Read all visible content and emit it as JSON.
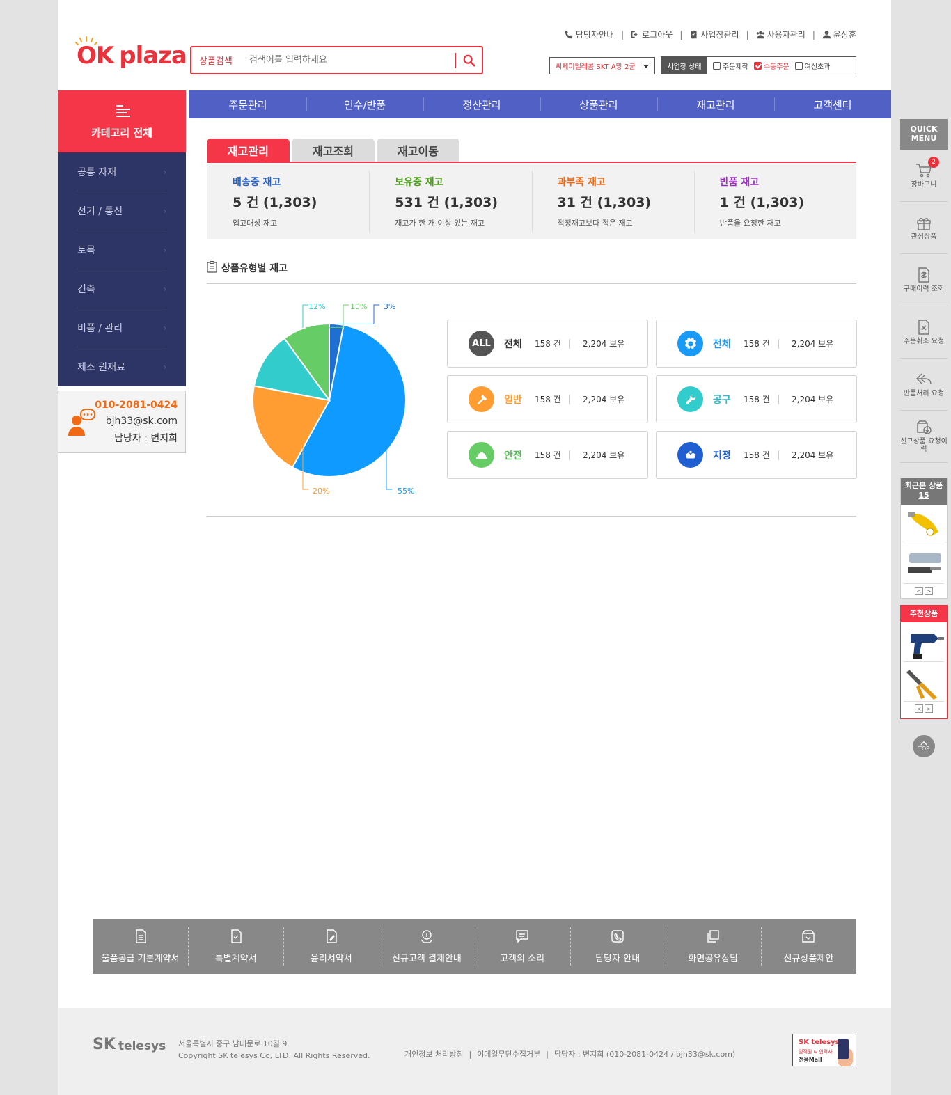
{
  "header": {
    "logo_ok": "OK",
    "logo_plaza": "plaza",
    "search_label": "상품검색",
    "search_placeholder": "검색어를 입력하세요",
    "util_links": [
      "담당자안내",
      "로그아웃",
      "사업장관리",
      "사용자관리",
      "윤상훈"
    ],
    "site_select": "씨제이텔레콤 SKT A망 2군",
    "status_label": "사업장 상태",
    "status_options": [
      {
        "label": "주문제작",
        "checked": false
      },
      {
        "label": "수동주문",
        "checked": true
      },
      {
        "label": "여신초과",
        "checked": false
      }
    ]
  },
  "sidebar": {
    "title": "카테고리 전체",
    "items": [
      "공통 자재",
      "전기 / 통신",
      "토목",
      "건축",
      "비품 / 관리",
      "제조 원재료"
    ],
    "contact_phone": "010-2081-0424",
    "contact_email": "bjh33@sk.com",
    "contact_manager": "담당자 : 변지희"
  },
  "nav": [
    "주문관리",
    "인수/반품",
    "정산관리",
    "상품관리",
    "재고관리",
    "고객센터"
  ],
  "tabs": [
    "재고관리",
    "재고조회",
    "재고이동"
  ],
  "summary": [
    {
      "title": "배송중 재고",
      "value": "5 건  (1,303)",
      "desc": "입고대상 재고",
      "color": "#2a63c5"
    },
    {
      "title": "보유중 재고",
      "value": "531 건  (1,303)",
      "desc": "재고가 한 개 이상 있는 재고",
      "color": "#4aa017"
    },
    {
      "title": "과부족 재고",
      "value": "31 건  (1,303)",
      "desc": "적정재고보다 적은 재고",
      "color": "#f06a15"
    },
    {
      "title": "반품 재고",
      "value": "1 건  (1,303)",
      "desc": "반품을 요청한 재고",
      "color": "#9a2fc0"
    }
  ],
  "section_title": "상품유형별 재고",
  "chart_data": {
    "type": "pie",
    "slices": [
      {
        "label": "3%",
        "value": 3,
        "color": "#1f6fd1"
      },
      {
        "label": "55%",
        "value": 55,
        "color": "#0f9aff"
      },
      {
        "label": "20%",
        "value": 20,
        "color": "#ff9d33"
      },
      {
        "label": "12%",
        "value": 12,
        "color": "#33cccc"
      },
      {
        "label": "10%",
        "value": 10,
        "color": "#66cc66"
      }
    ]
  },
  "cards": [
    {
      "icon": "all-icon",
      "icon_text": "ALL",
      "name": "전체",
      "count": "158 건",
      "stock": "2,204 보유",
      "color": "#555555",
      "name_color": "#333333"
    },
    {
      "icon": "gear-icon",
      "icon_text": "",
      "name": "전체",
      "count": "158 건",
      "stock": "2,204 보유",
      "color": "#1a9af7",
      "name_color": "#1a9af7"
    },
    {
      "icon": "hammer-icon",
      "icon_text": "",
      "name": "일반",
      "count": "158 건",
      "stock": "2,204 보유",
      "color": "#ff9d33",
      "name_color": "#ff9d33"
    },
    {
      "icon": "wrench-icon",
      "icon_text": "",
      "name": "공구",
      "count": "158 건",
      "stock": "2,204 보유",
      "color": "#33cccc",
      "name_color": "#33bbcc"
    },
    {
      "icon": "helmet-icon",
      "icon_text": "",
      "name": "안전",
      "count": "158 건",
      "stock": "2,204 보유",
      "color": "#66cc66",
      "name_color": "#55bb55"
    },
    {
      "icon": "designated-icon",
      "icon_text": "",
      "name": "지정",
      "count": "158 건",
      "stock": "2,204 보유",
      "color": "#1f5fd1",
      "name_color": "#1f5fd1"
    }
  ],
  "footer_links": [
    "물품공급 기본계약서",
    "특별계약서",
    "윤리서약서",
    "신규고객 결제안내",
    "고객의 소리",
    "담당자 안내",
    "화면공유상담",
    "신규상품제안"
  ],
  "footer": {
    "brand_sk": "SK",
    "brand_telesys": "telesys",
    "address": "서울특별시 중구 남대문로 10길 9",
    "copyright": "Copyright SK telesys Co, LTD. All Rights Reserved.",
    "policy_links": [
      "개인정보 처리방침",
      "이메일무단수집거부",
      "담당자 : 변지희 (010-2081-0424 / bjh33@sk.com)"
    ],
    "mall_a": "SK telesys",
    "mall_b": "임직원 & 협력사",
    "mall_c": "전용Mall"
  },
  "quick_menu": {
    "title": "QUICK MENU",
    "items": [
      "장바구니",
      "관심상품",
      "구매이력 조회",
      "주문취소 요청",
      "반품처리 요청",
      "신규상품 요청이력"
    ],
    "cart_count": "2",
    "recent_title": "최근본 상품",
    "recent_count": "15",
    "reco_title": "추천상품",
    "top": "TOP"
  }
}
